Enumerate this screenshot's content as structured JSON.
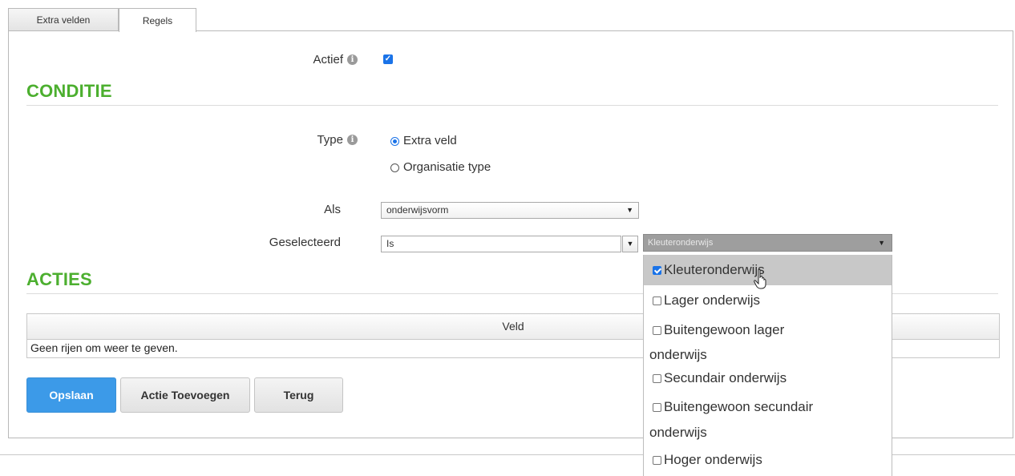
{
  "tabs": [
    {
      "label": "Extra velden",
      "active": false
    },
    {
      "label": "Regels",
      "active": true
    }
  ],
  "form": {
    "actief_label": "Actief",
    "actief_checked": true,
    "conditie_title": "CONDITIE",
    "type_label": "Type",
    "type_options": [
      {
        "label": "Extra veld",
        "checked": true
      },
      {
        "label": "Organisatie type",
        "checked": false
      }
    ],
    "als_label": "Als",
    "als_value": "onderwijsvorm",
    "geselecteerd_label": "Geselecteerd",
    "operator_value": "Is",
    "values_selected": "Kleuteronderwijs"
  },
  "acties": {
    "title": "ACTIES",
    "column_header": "Veld",
    "empty_text": "Geen rijen om weer te geven."
  },
  "buttons": {
    "save": "Opslaan",
    "add_action": "Actie Toevoegen",
    "back": "Terug"
  },
  "dropdown_options": [
    {
      "label": "Kleuteronderwijs",
      "checked": true
    },
    {
      "label": "Lager onderwijs",
      "checked": false
    },
    {
      "label": "Buitengewoon lager",
      "label2": "onderwijs",
      "checked": false
    },
    {
      "label": "Secundair onderwijs",
      "checked": false
    },
    {
      "label": "Buitengewoon secundair",
      "label2": "onderwijs",
      "checked": false
    },
    {
      "label": "Hoger onderwijs",
      "checked": false
    }
  ],
  "colors": {
    "section_title": "#4caf2f",
    "primary_button": "#3c9ae8",
    "checkbox": "#1a73e8"
  }
}
